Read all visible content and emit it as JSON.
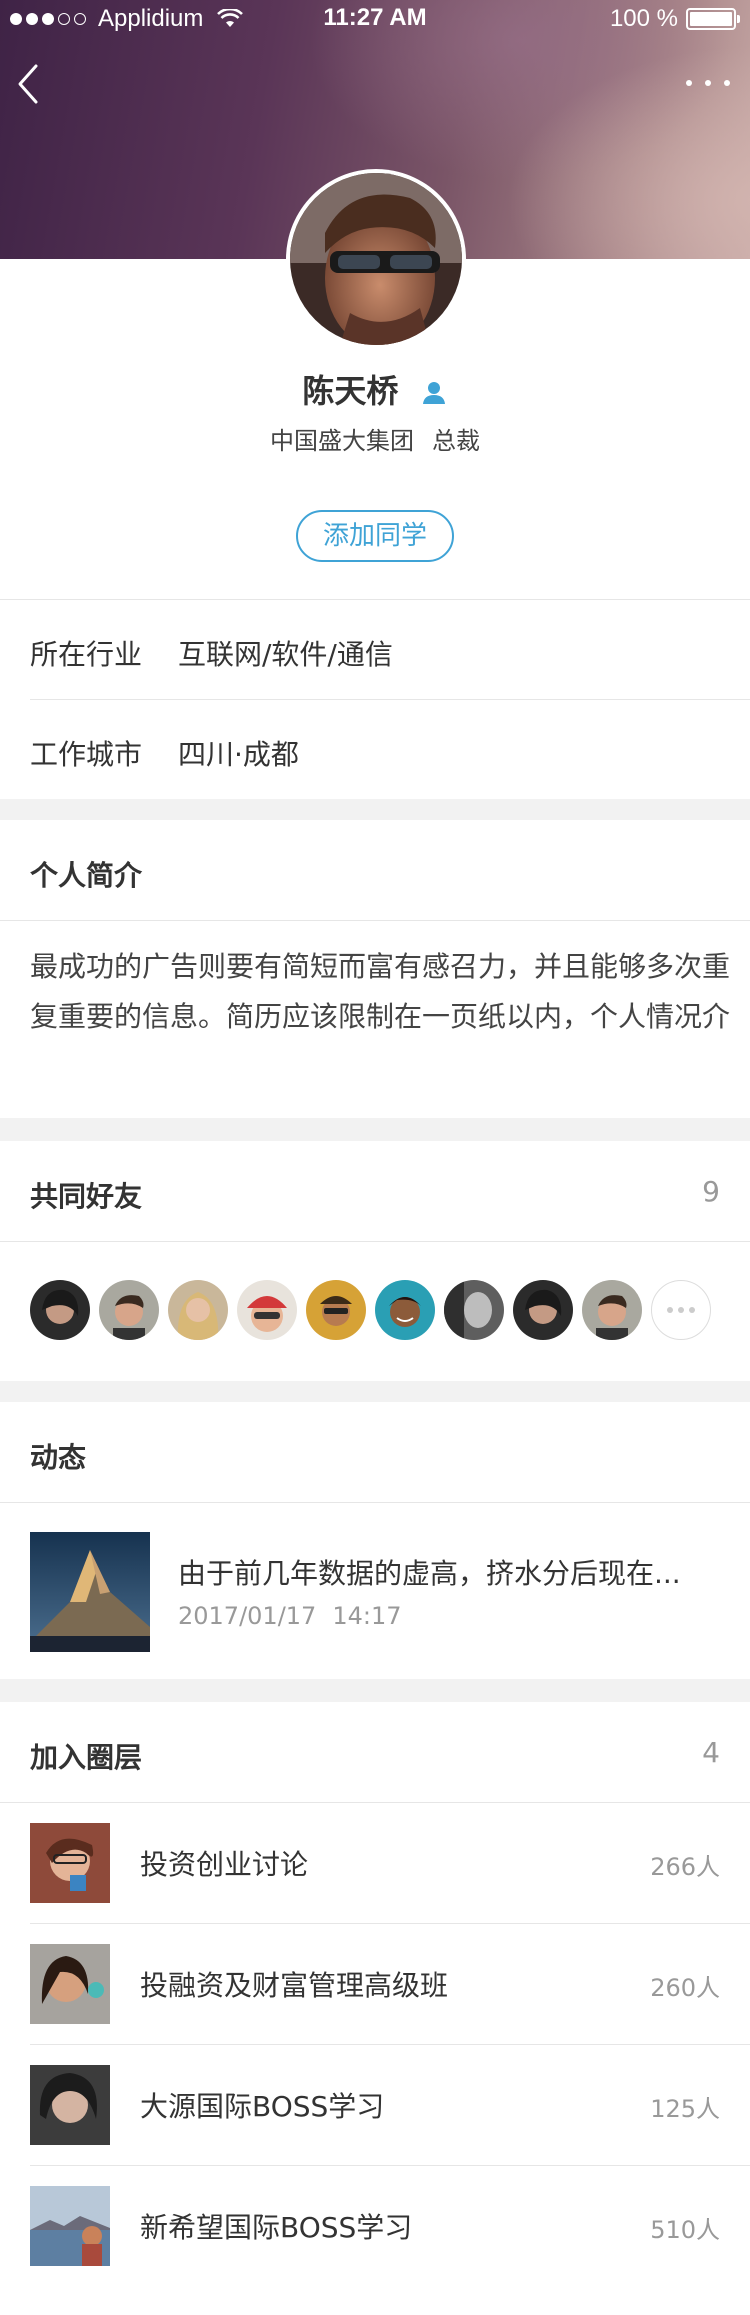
{
  "status_bar": {
    "carrier": "Applidium",
    "time": "11:27 AM",
    "battery": "100 %"
  },
  "profile": {
    "name": "陈天桥",
    "company": "中国盛大集团",
    "title": "总裁",
    "add_button": "添加同学"
  },
  "info": {
    "industry_label": "所在行业",
    "industry_value": "互联网/软件/通信",
    "city_label": "工作城市",
    "city_value": "四川·成都"
  },
  "bio": {
    "title": "个人简介",
    "text": "最成功的广告则要有简短而富有感召力，并且能够多次重复重要的信息。简历应该限制在一页纸以内，个人情况介"
  },
  "mutual_friends": {
    "title": "共同好友",
    "count": "9"
  },
  "feed": {
    "title": "动态",
    "item_text": "由于前几年数据的虚高，挤水分后现在...",
    "item_date": "2017/01/17",
    "item_time": "14:17"
  },
  "circles": {
    "title": "加入圈层",
    "count": "4",
    "items": [
      {
        "name": "投资创业讨论",
        "members": "266人"
      },
      {
        "name": "投融资及财富管理高级班",
        "members": "260人"
      },
      {
        "name": "大源国际BOSS学习",
        "members": "125人"
      },
      {
        "name": "新希望国际BOSS学习",
        "members": "510人"
      }
    ]
  },
  "colors": {
    "accent": "#3fa3d6",
    "background": "#f2f2f2"
  }
}
